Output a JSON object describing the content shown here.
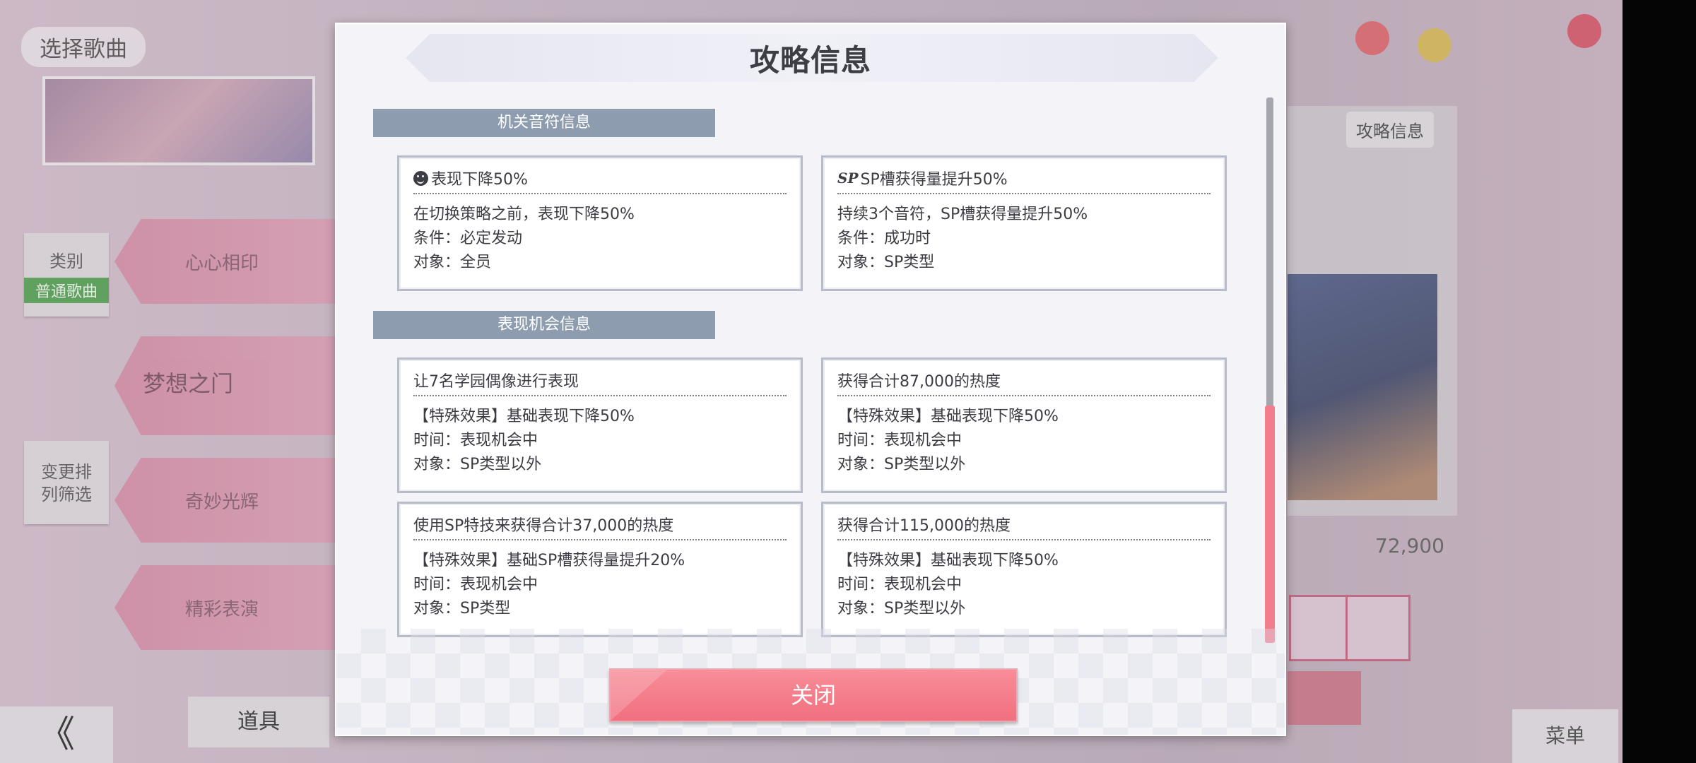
{
  "background": {
    "title": "选择歌曲",
    "chip_filter_label": "类别",
    "chip_filter_value": "普通歌曲",
    "chip_sort_label": "变更排列筛选",
    "songs": [
      "心心相印",
      "梦想之门",
      "奇妙光辉",
      "精彩表演"
    ],
    "back_glyph": "《",
    "item_button": "道具",
    "strategy_button": "攻略信息",
    "score": "72,900",
    "menu_button": "菜单"
  },
  "modal": {
    "title": "攻略信息",
    "sections": [
      {
        "header": "机关音符信息",
        "cards": [
          {
            "icon": "face-down-icon",
            "title": "表现下降50%",
            "lines": [
              "在切换策略之前，表现下降50%",
              "条件：必定发动",
              "对象：全员"
            ]
          },
          {
            "icon": "sp-icon",
            "icon_text": "SP",
            "title": "SP槽获得量提升50%",
            "lines": [
              "持续3个音符，SP槽获得量提升50%",
              "条件：成功时",
              "对象：SP类型"
            ]
          }
        ]
      },
      {
        "header": "表现机会信息",
        "cards": [
          {
            "title": "让7名学园偶像进行表现",
            "lines": [
              "【特殊效果】基础表现下降50%",
              "时间：表现机会中",
              "对象：SP类型以外"
            ]
          },
          {
            "title": "获得合计87,000的热度",
            "lines": [
              "【特殊效果】基础表现下降50%",
              "时间：表现机会中",
              "对象：SP类型以外"
            ]
          },
          {
            "title": "使用SP特技来获得合计37,000的热度",
            "lines": [
              "【特殊效果】基础SP槽获得量提升20%",
              "时间：表现机会中",
              "对象：SP类型"
            ]
          },
          {
            "title": "获得合计115,000的热度",
            "lines": [
              "【特殊效果】基础表现下降50%",
              "时间：表现机会中",
              "对象：SP类型以外"
            ]
          }
        ]
      }
    ],
    "close_button": "关闭"
  },
  "colors": {
    "section_header": "#8e9cb0",
    "close_button": "#f27d8b",
    "scroll_pink": "#f27d8b"
  }
}
